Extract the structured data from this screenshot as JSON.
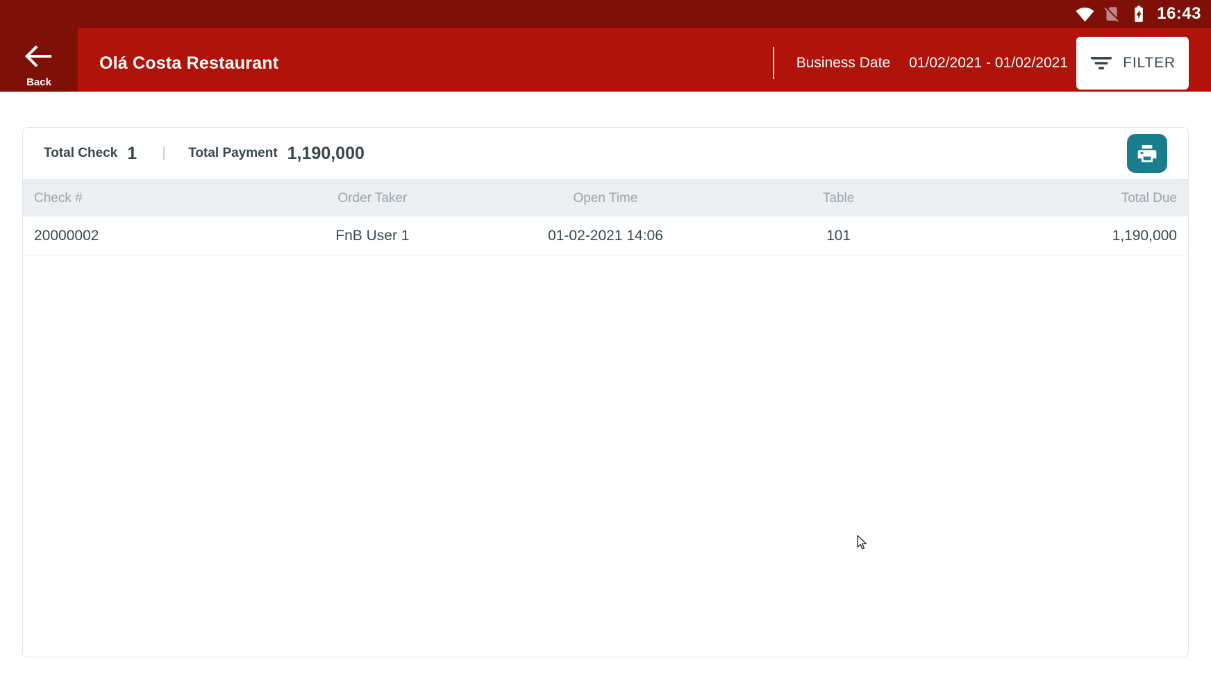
{
  "status_bar": {
    "time": "16:43",
    "icons": [
      "wifi-icon",
      "no-sim-icon",
      "battery-charging-icon"
    ]
  },
  "header": {
    "back_label": "Back",
    "title": "Olá Costa Restaurant",
    "business_date_label": "Business Date",
    "business_date_value": "01/02/2021 - 01/02/2021",
    "filter_label": "FILTER"
  },
  "summary": {
    "total_check_label": "Total Check",
    "total_check_value": "1",
    "total_payment_label": "Total Payment",
    "total_payment_value": "1,190,000"
  },
  "table": {
    "columns": [
      "Check #",
      "Order Taker",
      "Open Time",
      "Table",
      "Total Due"
    ],
    "rows": [
      [
        "20000002",
        "FnB User 1",
        "01-02-2021 14:06",
        "101",
        "1,190,000"
      ]
    ]
  },
  "colors": {
    "status_bar_bg": "#7E1008",
    "header_bg": "#B0130A",
    "print_button_teal": "#1A7D8E",
    "text_dark": "#37474F",
    "table_header_bg": "#ECEFF1",
    "table_header_text": "#98A5AF"
  }
}
